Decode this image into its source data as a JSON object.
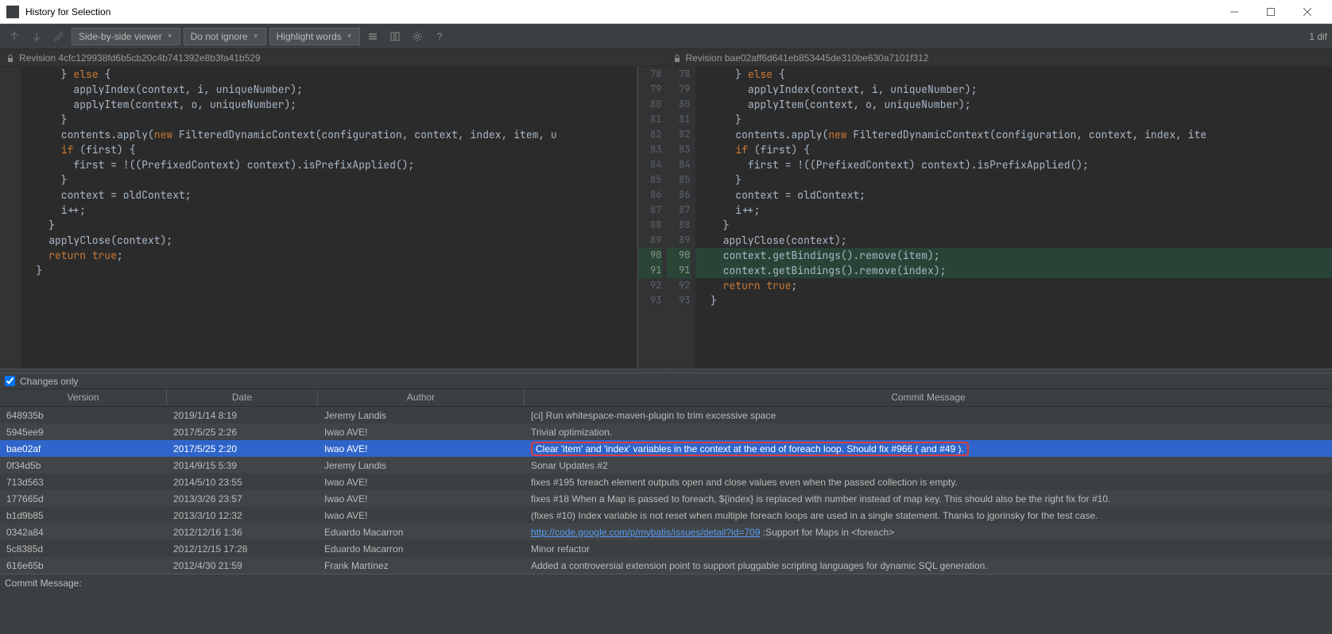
{
  "window": {
    "title": "History for Selection",
    "min_label": "Minimize",
    "max_label": "Maximize",
    "close_label": "Close"
  },
  "toolbar": {
    "viewer_mode": "Side-by-side viewer",
    "ignore_mode": "Do not ignore",
    "highlight_mode": "Highlight words",
    "diff_count": "1 dif"
  },
  "diff": {
    "left_revision": "Revision 4cfc129938fd6b5cb20c4b741392e8b3fa41b529",
    "right_revision": "Revision bae02aff6d641eb853445de310be630a7101f312",
    "right_line_start": 78
  },
  "code_left": [
    "      } else {",
    "        applyIndex(context, i, uniqueNumber);",
    "        applyItem(context, o, uniqueNumber);",
    "      }",
    "      contents.apply(new FilteredDynamicContext(configuration, context, index, item, u",
    "      if (first) {",
    "        first = !((PrefixedContext) context).isPrefixApplied();",
    "      }",
    "      context = oldContext;",
    "      i++;",
    "    }",
    "    applyClose(context);",
    "    return true;",
    "  }"
  ],
  "code_right": [
    {
      "n": 78,
      "t": "      } else {",
      "added": false
    },
    {
      "n": 79,
      "t": "        applyIndex(context, i, uniqueNumber);",
      "added": false
    },
    {
      "n": 80,
      "t": "        applyItem(context, o, uniqueNumber);",
      "added": false
    },
    {
      "n": 81,
      "t": "      }",
      "added": false
    },
    {
      "n": 82,
      "t": "      contents.apply(new FilteredDynamicContext(configuration, context, index, ite",
      "added": false
    },
    {
      "n": 83,
      "t": "      if (first) {",
      "added": false
    },
    {
      "n": 84,
      "t": "        first = !((PrefixedContext) context).isPrefixApplied();",
      "added": false
    },
    {
      "n": 85,
      "t": "      }",
      "added": false
    },
    {
      "n": 86,
      "t": "      context = oldContext;",
      "added": false
    },
    {
      "n": 87,
      "t": "      i++;",
      "added": false
    },
    {
      "n": 88,
      "t": "    }",
      "added": false
    },
    {
      "n": 89,
      "t": "    applyClose(context);",
      "added": false
    },
    {
      "n": 90,
      "t": "    context.getBindings().remove(item);",
      "added": true
    },
    {
      "n": 91,
      "t": "    context.getBindings().remove(index);",
      "added": true
    },
    {
      "n": 92,
      "t": "    return true;",
      "added": false
    },
    {
      "n": 93,
      "t": "  }",
      "added": false
    }
  ],
  "changes_only_label": "Changes only",
  "columns": {
    "version": "Version",
    "date": "Date",
    "author": "Author",
    "msg": "Commit Message"
  },
  "commits": [
    {
      "version": "648935b",
      "date": "2019/1/14 8:19",
      "author": "Jeremy Landis",
      "msg": "[ci] Run whitespace-maven-plugin to trim excessive space",
      "selected": false,
      "link": null
    },
    {
      "version": "5945ee9",
      "date": "2017/5/25 2:26",
      "author": "Iwao AVE!",
      "msg": "Trivial optimization.",
      "selected": false,
      "link": null
    },
    {
      "version": "bae02af",
      "date": "2017/5/25 2:20",
      "author": "Iwao AVE!",
      "msg": "Clear 'item' and 'index' variables in the context at the end of foreach loop. Should fix #966 ( and #49 ).",
      "selected": true,
      "link": null
    },
    {
      "version": "0f34d5b",
      "date": "2014/9/15 5:39",
      "author": "Jeremy Landis",
      "msg": "Sonar Updates #2",
      "selected": false,
      "link": null
    },
    {
      "version": "713d563",
      "date": "2014/5/10 23:55",
      "author": "Iwao AVE!",
      "msg": "fixes #195 foreach element outputs open and close values even when the passed collection is empty.",
      "selected": false,
      "link": null
    },
    {
      "version": "177665d",
      "date": "2013/3/26 23:57",
      "author": "Iwao AVE!",
      "msg": "fixes #18 When a Map is passed to foreach, ${index} is replaced with number instead of map key. This should also be the right fix for #10.",
      "selected": false,
      "link": null
    },
    {
      "version": "b1d9b85",
      "date": "2013/3/10 12:32",
      "author": "Iwao AVE!",
      "msg": "(fixes #10) Index variable is not reset when multiple foreach loops are used in a single statement. Thanks to jgorinsky for the test case.",
      "selected": false,
      "link": null
    },
    {
      "version": "0342a84",
      "date": "2012/12/16 1:36",
      "author": "Eduardo Macarron",
      "msg": " :Support for Maps in <foreach>",
      "selected": false,
      "link": "http://code.google.com/p/mybatis/issues/detail?id=709"
    },
    {
      "version": "5c8385d",
      "date": "2012/12/15 17:28",
      "author": "Eduardo Macarron",
      "msg": "Minor refactor",
      "selected": false,
      "link": null
    },
    {
      "version": "616e65b",
      "date": "2012/4/30 21:59",
      "author": "Frank Martínez",
      "msg": "Added a controversial extension point to support pluggable scripting languages for dynamic SQL generation.",
      "selected": false,
      "link": null
    }
  ],
  "status": {
    "label": "Commit Message:"
  }
}
